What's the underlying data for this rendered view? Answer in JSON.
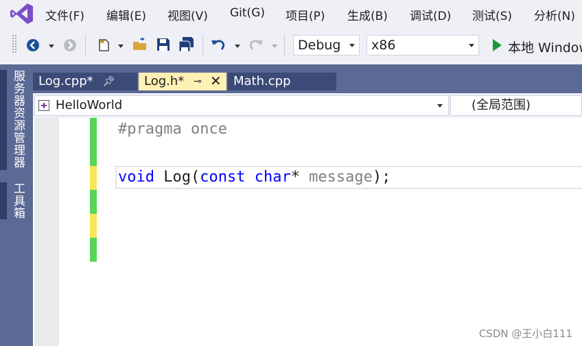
{
  "menu": [
    "文件(F)",
    "编辑(E)",
    "视图(V)",
    "Git(G)",
    "项目(P)",
    "生成(B)",
    "调试(D)",
    "测试(S)",
    "分析(N)"
  ],
  "toolbar": {
    "config": "Debug",
    "platform": "x86",
    "run_label": "本地 Windows"
  },
  "side_panel": {
    "server_explorer": "服务器资源管理器",
    "toolbox": "工具箱"
  },
  "tabs": [
    {
      "label": "Log.cpp*",
      "active": false
    },
    {
      "label": "Log.h*",
      "active": true
    },
    {
      "label": "Math.cpp",
      "active": false
    }
  ],
  "navbar": {
    "project": "HelloWorld",
    "scope": "(全局范围)"
  },
  "code": {
    "line1": {
      "directive": "#pragma once"
    },
    "line2": {
      "kw1": "void",
      "fn": " Log",
      "paren1": "(",
      "kw2": "const",
      "sp": " ",
      "kw3": "char",
      "star": "*",
      "param": " message",
      "end": ");"
    }
  },
  "colors": {
    "keyword": "#0000ff",
    "preprocessor": "#808080",
    "param": "#808080",
    "change_saved": "#57d657",
    "change_unsaved": "#f5e65a",
    "active_tab": "#fff0b3",
    "panel": "#5b6a94"
  },
  "watermark": "CSDN @王小白111"
}
